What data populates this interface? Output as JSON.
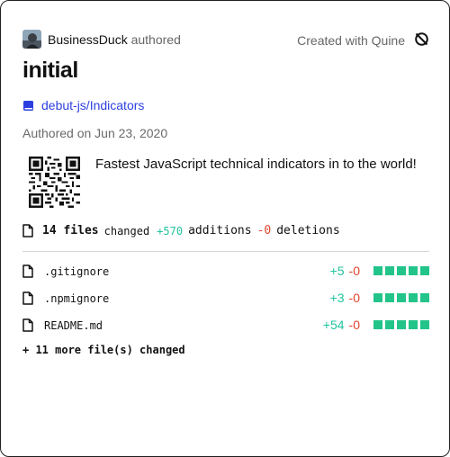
{
  "header": {
    "author_name": "BusinessDuck",
    "author_verb": "authored",
    "created_with": "Created with Quine"
  },
  "commit": {
    "title": "initial",
    "repo": "debut-js/Indicators",
    "authored_date": "Authored on Jun 23, 2020",
    "description": "Fastest JavaScript technical indicators in to the world!"
  },
  "summary": {
    "files_count": "14 files",
    "changed_label": "changed",
    "additions": "+570",
    "additions_label": "additions",
    "deletions": "-0",
    "deletions_label": "deletions"
  },
  "files": [
    {
      "name": ".gitignore",
      "additions": "+5",
      "deletions": "-0"
    },
    {
      "name": ".npmignore",
      "additions": "+3",
      "deletions": "-0"
    },
    {
      "name": "README.md",
      "additions": "+54",
      "deletions": "-0"
    }
  ],
  "more_files": "+ 11 more file(s) changed",
  "colors": {
    "addition": "#22c4a0",
    "deletion": "#e0442e",
    "link": "#2c3fe0",
    "diff_block": "#22c48a"
  },
  "icons": {
    "avatar": "user-avatar",
    "quine": "quine-logo-icon",
    "repo": "book-icon",
    "file": "file-icon"
  }
}
